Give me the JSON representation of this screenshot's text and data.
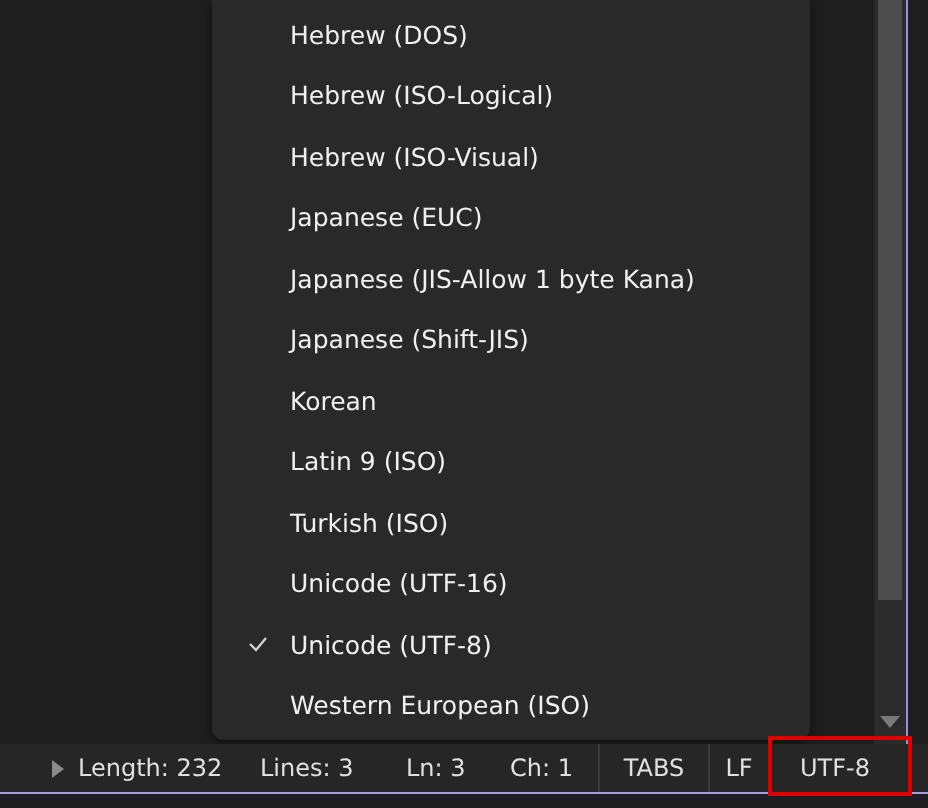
{
  "encoding_menu": {
    "items": [
      {
        "label": "Hebrew (DOS)",
        "selected": false
      },
      {
        "label": "Hebrew (ISO-Logical)",
        "selected": false
      },
      {
        "label": "Hebrew (ISO-Visual)",
        "selected": false
      },
      {
        "label": "Japanese (EUC)",
        "selected": false
      },
      {
        "label": "Japanese (JIS-Allow 1 byte Kana)",
        "selected": false
      },
      {
        "label": "Japanese (Shift-JIS)",
        "selected": false
      },
      {
        "label": "Korean",
        "selected": false
      },
      {
        "label": "Latin 9 (ISO)",
        "selected": false
      },
      {
        "label": "Turkish (ISO)",
        "selected": false
      },
      {
        "label": "Unicode (UTF-16)",
        "selected": false
      },
      {
        "label": "Unicode (UTF-8)",
        "selected": true
      },
      {
        "label": "Western European (ISO)",
        "selected": false
      }
    ]
  },
  "status_bar": {
    "info": [
      "Length: 232",
      "Lines: 3",
      "Ln: 3",
      "Ch: 1"
    ],
    "buttons": [
      {
        "label": "TABS",
        "highlighted": false
      },
      {
        "label": "LF",
        "highlighted": false
      },
      {
        "label": "UTF-8",
        "highlighted": true
      }
    ]
  }
}
